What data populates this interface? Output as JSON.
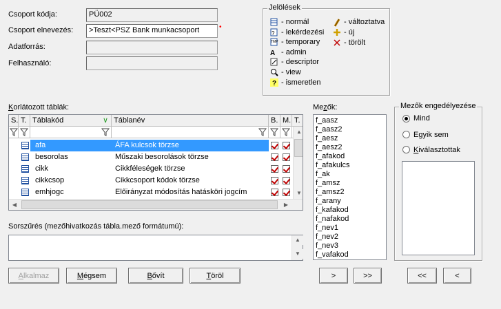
{
  "form": {
    "group_code_label": "Csoport kódja:",
    "group_code_value": "PÜ002",
    "group_name_label": "Csoport elnevezés:",
    "group_name_value": ">Teszt<PSZ Bank munkacsoport",
    "datasource_label": "Adatforrás:",
    "datasource_value": "",
    "user_label": "Felhasználó:",
    "user_value": ""
  },
  "legend": {
    "title": "Jelölések",
    "items": [
      {
        "label": "- normál",
        "icon": "table-icon"
      },
      {
        "label": "- lekérdezési",
        "icon": "query-icon"
      },
      {
        "label": "- temporary",
        "icon": "temp-table-icon"
      },
      {
        "label": "- admin",
        "icon": "admin-icon"
      },
      {
        "label": "- descriptor",
        "icon": "descriptor-icon"
      },
      {
        "label": "- view",
        "icon": "view-icon"
      },
      {
        "label": "- ismeretlen",
        "icon": "unknown-icon"
      }
    ],
    "status_items": [
      {
        "label": "- változtatva",
        "icon": "pencil-icon"
      },
      {
        "label": "- új",
        "icon": "plus-icon"
      },
      {
        "label": "- törölt",
        "icon": "x-icon"
      }
    ]
  },
  "tables": {
    "label": "Korlátozott táblák:",
    "columns": [
      "S.",
      "T.",
      "Táblakód",
      "Táblanév",
      "B.",
      "M.",
      "T."
    ],
    "rows": [
      {
        "code": "afa",
        "name": "ÁFA kulcsok törzse",
        "b": true,
        "m": true,
        "t": false
      },
      {
        "code": "besorolas",
        "name": "Műszaki besorolások törzse",
        "b": true,
        "m": true,
        "t": true
      },
      {
        "code": "cikk",
        "name": "Cikkféleségek törzse",
        "b": true,
        "m": true,
        "t": true
      },
      {
        "code": "cikkcsop",
        "name": "Cikkcsoport kódok törzse",
        "b": true,
        "m": true,
        "t": true
      },
      {
        "code": "emhjogc",
        "name": "Előirányzat módosítás hatásköri jogcím",
        "b": true,
        "m": true,
        "t": true
      }
    ]
  },
  "filter": {
    "label": "Sorszűrés (mezőhivatkozás tábla.mező formátumú):",
    "value": ""
  },
  "fields": {
    "label": "Mezők:",
    "items": [
      "f_aasz",
      "f_aasz2",
      "f_aesz",
      "f_aesz2",
      "f_afakod",
      "f_afakulcs",
      "f_ak",
      "f_amsz",
      "f_amsz2",
      "f_arany",
      "f_kafakod",
      "f_nafakod",
      "f_nev1",
      "f_nev2",
      "f_nev3",
      "f_vafakod"
    ]
  },
  "permission": {
    "title": "Mezők engedélyezése",
    "options": [
      "Mind",
      "Egyik sem",
      "Kiválasztottak"
    ],
    "selected": "Mind"
  },
  "buttons": {
    "apply": "Alkalmaz",
    "cancel": "Mégsem",
    "expand": "Bővít",
    "delete": "Töröl",
    "move_right": ">",
    "move_all_right": ">>",
    "move_all_left": "<<",
    "move_left": "<"
  },
  "colors": {
    "selection": "#3399ff",
    "check": "#c00000",
    "required_marker": "#ff0000"
  }
}
